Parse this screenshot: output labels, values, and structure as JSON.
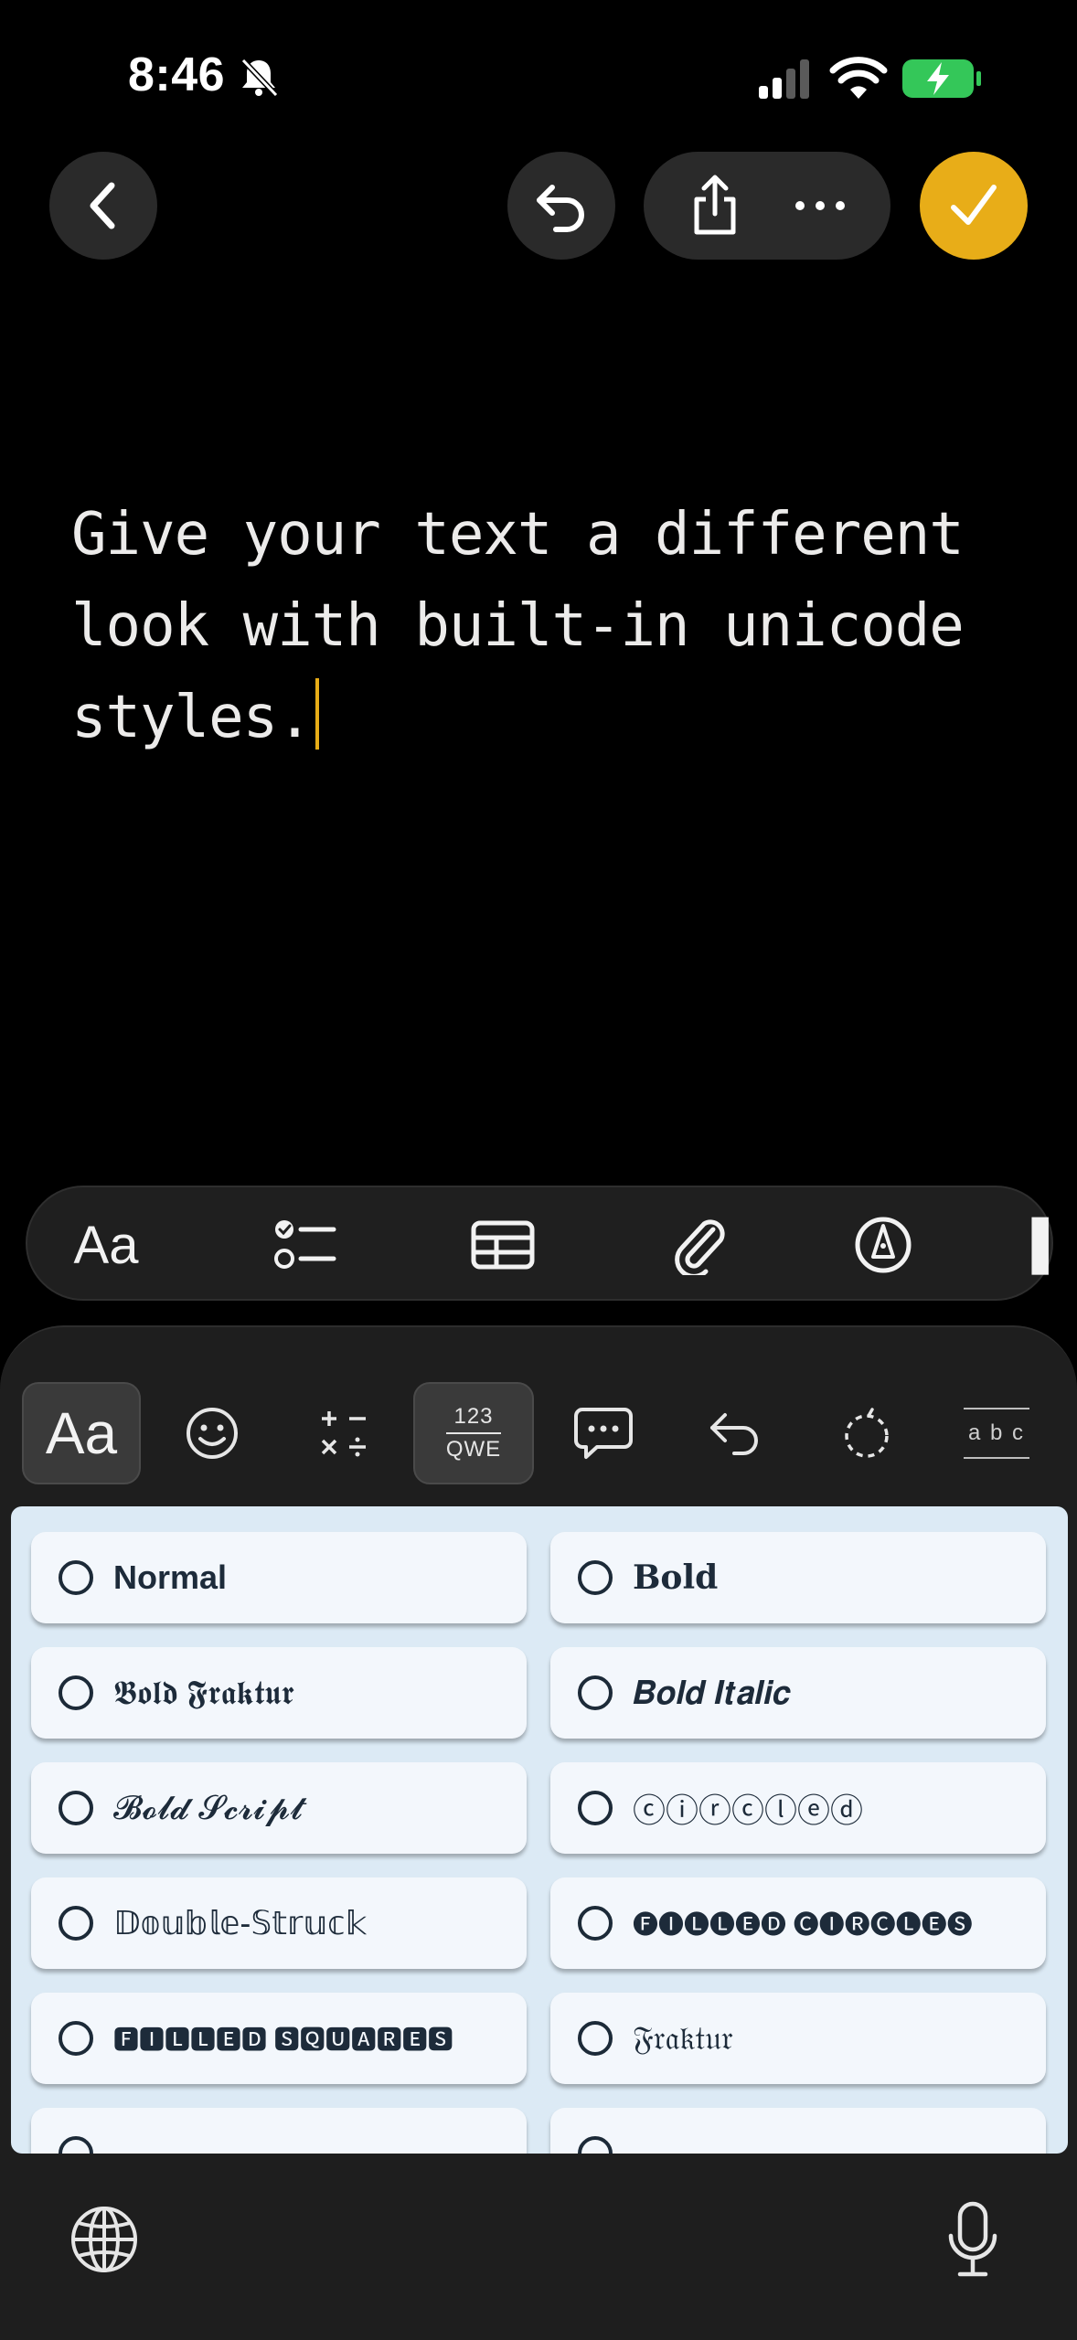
{
  "status": {
    "time": "8:46"
  },
  "note": {
    "text": "Give your text a different look with built-in unicode styles."
  },
  "toolbar": {
    "aa_label": "Aa"
  },
  "keyboard": {
    "aa_label": "Aa",
    "num_top": "123",
    "num_bottom": "QWE",
    "strike_label": "a b c"
  },
  "styles": [
    {
      "label": "Normal"
    },
    {
      "label": "Bold"
    },
    {
      "label": "𝕭𝖔𝖑𝖉 𝕱𝖗𝖆𝖐𝖙𝖚𝖗"
    },
    {
      "label": "𝑩𝒐𝒍𝒅 𝑰𝒕𝒂𝒍𝒊𝒄"
    },
    {
      "label": "𝓑𝓸𝓵𝓭 𝓢𝓬𝓻𝓲𝓹𝓽"
    },
    {
      "label": "ⓒⓘⓡⓒⓛⓔⓓ"
    },
    {
      "label": "𝔻𝕠𝕦𝕓𝕝𝕖-𝕊𝕥𝕣𝕦𝕔𝕜"
    },
    {
      "label": "🅕🅘🅛🅛🅔🅓 🅒🅘🅡🅒🅛🅔🅢"
    },
    {
      "label": "🅵🅸🅻🅻🅴🅳 🆂🆀🆄🅰🆁🅴🆂"
    },
    {
      "label": "𝔉𝔯𝔞𝔨𝔱𝔲𝔯"
    }
  ],
  "colors": {
    "accent": "#e8ad18",
    "panel_bg": "#dceaf5",
    "card_bg": "#f3f7fc"
  }
}
